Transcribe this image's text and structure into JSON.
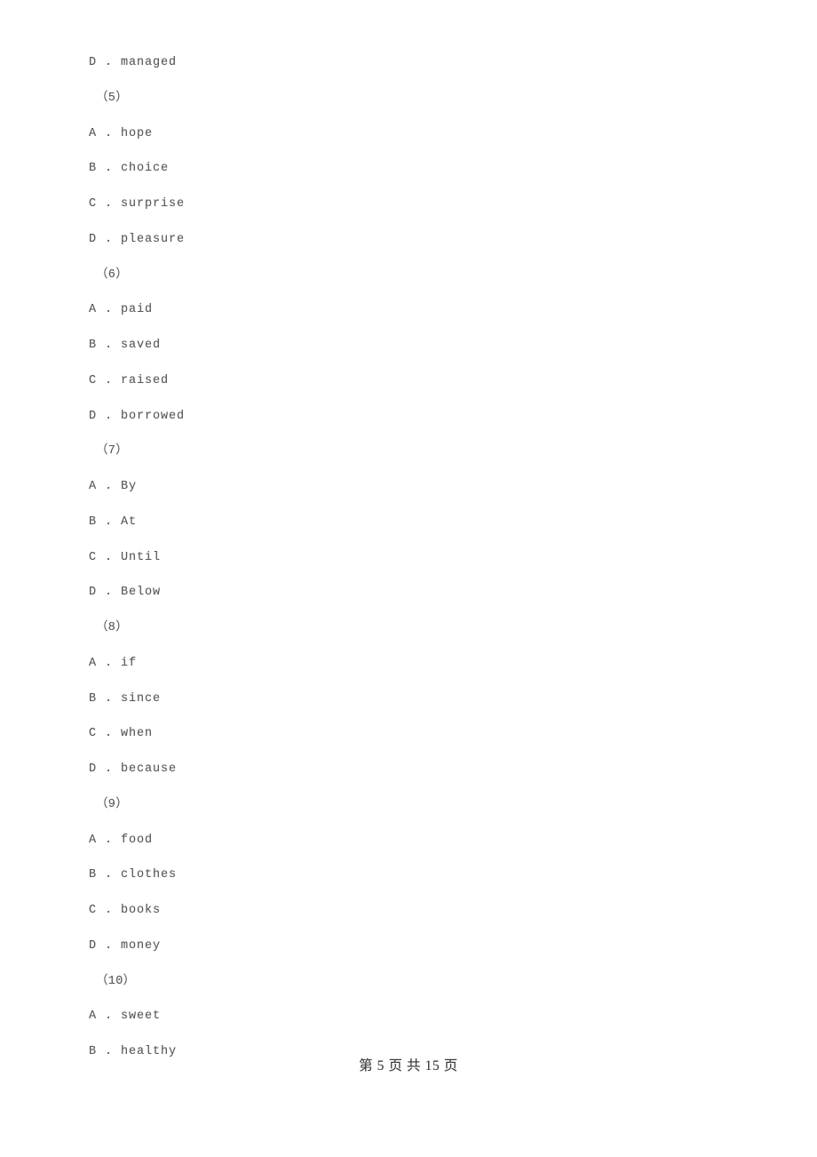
{
  "document": {
    "background_color": "#ffffff",
    "text_color": "#59595c",
    "footer_text_color": "#3a3a3d"
  },
  "lines": [
    {
      "kind": "option",
      "text": "D . managed"
    },
    {
      "kind": "qnum",
      "text": "（5）"
    },
    {
      "kind": "option",
      "text": "A . hope"
    },
    {
      "kind": "option",
      "text": "B . choice"
    },
    {
      "kind": "option",
      "text": "C . surprise"
    },
    {
      "kind": "option",
      "text": "D . pleasure"
    },
    {
      "kind": "qnum",
      "text": "（6）"
    },
    {
      "kind": "option",
      "text": "A . paid"
    },
    {
      "kind": "option",
      "text": "B . saved"
    },
    {
      "kind": "option",
      "text": "C . raised"
    },
    {
      "kind": "option",
      "text": "D . borrowed"
    },
    {
      "kind": "qnum",
      "text": "（7）"
    },
    {
      "kind": "option",
      "text": "A . By"
    },
    {
      "kind": "option",
      "text": "B . At"
    },
    {
      "kind": "option",
      "text": "C . Until"
    },
    {
      "kind": "option",
      "text": "D . Below"
    },
    {
      "kind": "qnum",
      "text": "（8）"
    },
    {
      "kind": "option",
      "text": "A . if"
    },
    {
      "kind": "option",
      "text": "B . since"
    },
    {
      "kind": "option",
      "text": "C . when"
    },
    {
      "kind": "option",
      "text": "D . because"
    },
    {
      "kind": "qnum",
      "text": "（9）"
    },
    {
      "kind": "option",
      "text": "A . food"
    },
    {
      "kind": "option",
      "text": "B . clothes"
    },
    {
      "kind": "option",
      "text": "C . books"
    },
    {
      "kind": "option",
      "text": "D . money"
    },
    {
      "kind": "qnum",
      "text": "（10）"
    },
    {
      "kind": "option",
      "text": "A . sweet"
    },
    {
      "kind": "option",
      "text": "B . healthy"
    }
  ],
  "footer": {
    "text": "第 5 页 共 15 页",
    "page_number": 5,
    "total_pages": 15
  }
}
